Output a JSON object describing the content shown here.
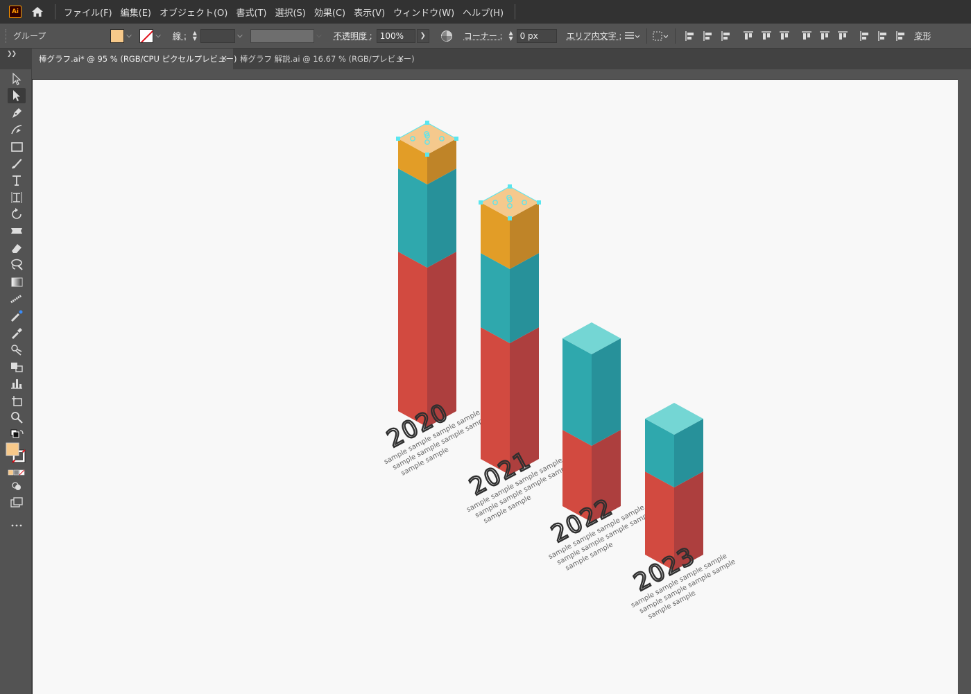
{
  "app": {
    "logo": "Ai"
  },
  "menu": [
    "ファイル(F)",
    "編集(E)",
    "オブジェクト(O)",
    "書式(T)",
    "選択(S)",
    "効果(C)",
    "表示(V)",
    "ウィンドウ(W)",
    "ヘルプ(H)"
  ],
  "control": {
    "selection_label": "グループ",
    "fill_color": "#f7c98a",
    "stroke_label": "線 :",
    "opacity_label": "不透明度 :",
    "opacity_value": "100%",
    "corner_label": "コーナー :",
    "corner_value": "0 px",
    "area_text_label": "エリア内文字 :",
    "transform_label": "変形"
  },
  "tabs": [
    {
      "label": "棒グラフ.ai* @ 95 % (RGB/CPU ピクセルプレビュー)",
      "close": "×",
      "active": true
    },
    {
      "label": "棒グラフ 解説.ai @ 16.67 % (RGB/プレビュー)",
      "close": "×",
      "active": false
    }
  ],
  "tools": [
    "selection-tool",
    "direct-selection-tool",
    "pen-tool",
    "curvature-tool",
    "rectangle-tool",
    "paintbrush-tool",
    "type-tool",
    "artboard-text-tool",
    "rotate-tool",
    "width-tool",
    "eraser-tool",
    "lasso-tool",
    "gradient-tool",
    "blend-tool",
    "symbol-sprayer-tool",
    "eyedropper-tool",
    "shape-builder-tool",
    "live-paint-tool",
    "graph-tool",
    "artboard-tool",
    "zoom-tool"
  ],
  "artwork": {
    "colors": {
      "red_front": "#d24a40",
      "red_side": "#ad3f3e",
      "teal_front": "#2fa8ad",
      "teal_side": "#27919a",
      "teal_top": "#74d6d4",
      "orange_front": "#e29d27",
      "orange_side": "#bf8428",
      "orange_top": "#f5c98d",
      "text": "#2f2f2f",
      "selection": "#5ae6ef"
    },
    "bars": [
      {
        "year": "2020",
        "desc": [
          "sample sample sample sample",
          "sample sample sample sample",
          "sample sample"
        ]
      },
      {
        "year": "2021",
        "desc": [
          "sample sample sample sample",
          "sample sample sample sample",
          "sample sample"
        ]
      },
      {
        "year": "2022",
        "desc": [
          "sample sample sample sample",
          "sample sample sample sample",
          "sample sample"
        ]
      },
      {
        "year": "2023",
        "desc": [
          "sample sample sample sample",
          "sample sample sample sample",
          "sample sample"
        ]
      }
    ]
  }
}
